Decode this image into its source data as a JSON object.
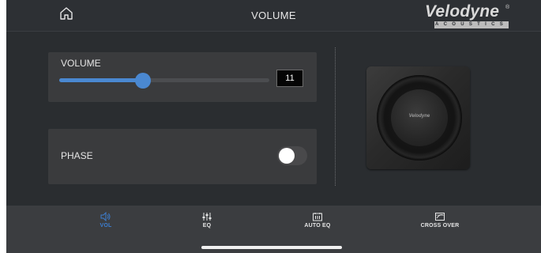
{
  "header": {
    "title": "VOLUME",
    "home_icon": "home-icon",
    "logo": {
      "brand": "Velodyne",
      "subtitle": "ACOUSTICS"
    }
  },
  "volume": {
    "label": "VOLUME",
    "value": "11",
    "slider_fraction": 0.4
  },
  "phase": {
    "label": "PHASE",
    "enabled": false
  },
  "product_image": {
    "brand": "Velodyne"
  },
  "nav": {
    "items": [
      {
        "label": "VOL",
        "icon": "speaker-icon",
        "active": true
      },
      {
        "label": "EQ",
        "icon": "sliders-icon",
        "active": false
      },
      {
        "label": "AUTO EQ",
        "icon": "auto-eq-icon",
        "active": false
      },
      {
        "label": "CROSS OVER",
        "icon": "crossover-icon",
        "active": false
      }
    ]
  },
  "colors": {
    "accent": "#4a88d1",
    "background": "#2a2d30",
    "panel": "#3a3b3d"
  }
}
